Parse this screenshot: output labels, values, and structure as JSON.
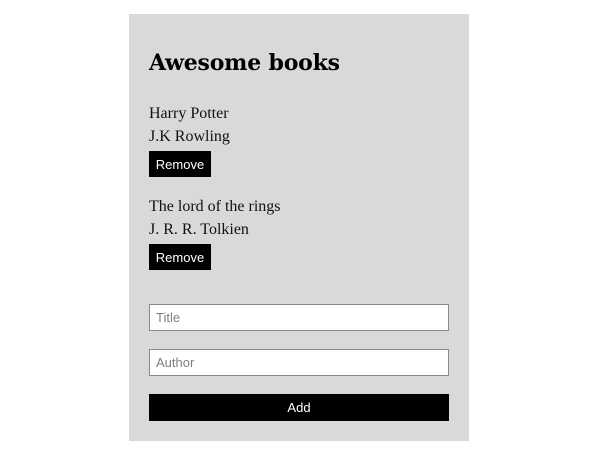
{
  "app": {
    "title": "Awesome books"
  },
  "books": [
    {
      "title": "Harry Potter",
      "author": "J.K Rowling",
      "remove_label": "Remove"
    },
    {
      "title": "The lord of the rings",
      "author": "J. R. R. Tolkien",
      "remove_label": "Remove"
    }
  ],
  "form": {
    "title_placeholder": "Title",
    "author_placeholder": "Author",
    "add_label": "Add"
  }
}
